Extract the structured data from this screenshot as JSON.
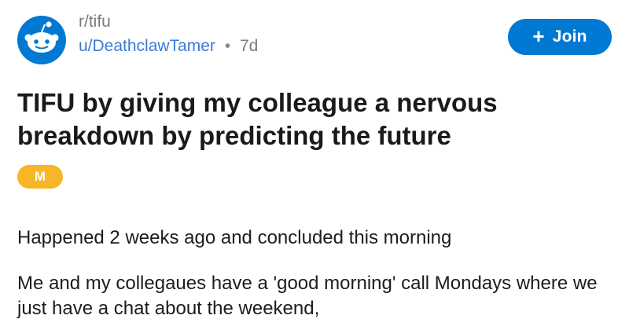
{
  "post": {
    "subreddit": "r/tifu",
    "author": "u/DeathclawTamer",
    "separator": "•",
    "age": "7d",
    "join_plus": "+",
    "join_label": "Join",
    "title": "TIFU by giving my colleague a nervous breakdown by predicting the future",
    "flair": "M",
    "body": [
      "Happened 2 weeks ago and concluded this morning",
      "Me and my collegaues have a 'good morning' call Mondays where we just have a chat about the weekend,"
    ]
  },
  "colors": {
    "brand_blue": "#0079d3",
    "username_blue": "#3a7bd5",
    "flair_yellow": "#f6b626"
  },
  "icons": {
    "avatar": "reddit-snoo-icon",
    "join": "plus-icon"
  }
}
